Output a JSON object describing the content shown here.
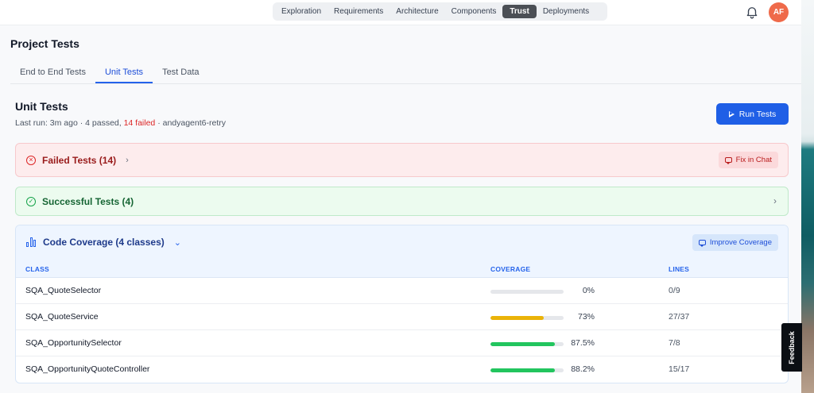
{
  "nav": {
    "items": [
      {
        "label": "Exploration",
        "active": false
      },
      {
        "label": "Requirements",
        "active": false
      },
      {
        "label": "Architecture",
        "active": false
      },
      {
        "label": "Components",
        "active": false
      },
      {
        "label": "Trust",
        "active": true
      },
      {
        "label": "Deployments",
        "active": false
      }
    ],
    "bell_icon": "bell-icon",
    "avatar": "AF",
    "avatar_color": "#ef6a4a"
  },
  "page": {
    "title": "Project Tests",
    "tabs": [
      {
        "label": "End to End Tests",
        "active": false
      },
      {
        "label": "Unit Tests",
        "active": true
      },
      {
        "label": "Test Data",
        "active": false
      }
    ]
  },
  "unit_tests": {
    "title": "Unit Tests",
    "last_run_prefix": "Last run: 3m ago · 4 passed, ",
    "last_run_failed": "14 failed",
    "last_run_suffix": " · andyagent6-retry",
    "run_button": "Run Tests"
  },
  "failed_tests": {
    "label": "Failed Tests (14)",
    "fix_button": "Fix in Chat",
    "color": "#dc2626"
  },
  "successful_tests": {
    "label": "Successful Tests (4)",
    "color": "#16a34a"
  },
  "coverage": {
    "label": "Code Coverage (4 classes)",
    "improve_button": "Improve Coverage",
    "columns": [
      "CLASS",
      "COVERAGE",
      "LINES"
    ],
    "rows": [
      {
        "cls": "SQA_QuoteSelector",
        "coverage": 0,
        "pct": "0%",
        "lines": "0/9",
        "color": "#e5e7eb"
      },
      {
        "cls": "SQA_QuoteService",
        "coverage": 73,
        "pct": "73%",
        "lines": "27/37",
        "color": "#eab308"
      },
      {
        "cls": "SQA_OpportunitySelector",
        "coverage": 87.5,
        "pct": "87.5%",
        "lines": "7/8",
        "color": "#22c55e"
      },
      {
        "cls": "SQA_OpportunityQuoteController",
        "coverage": 88.2,
        "pct": "88.2%",
        "lines": "15/17",
        "color": "#22c55e"
      }
    ]
  },
  "feedback": "Feedback"
}
